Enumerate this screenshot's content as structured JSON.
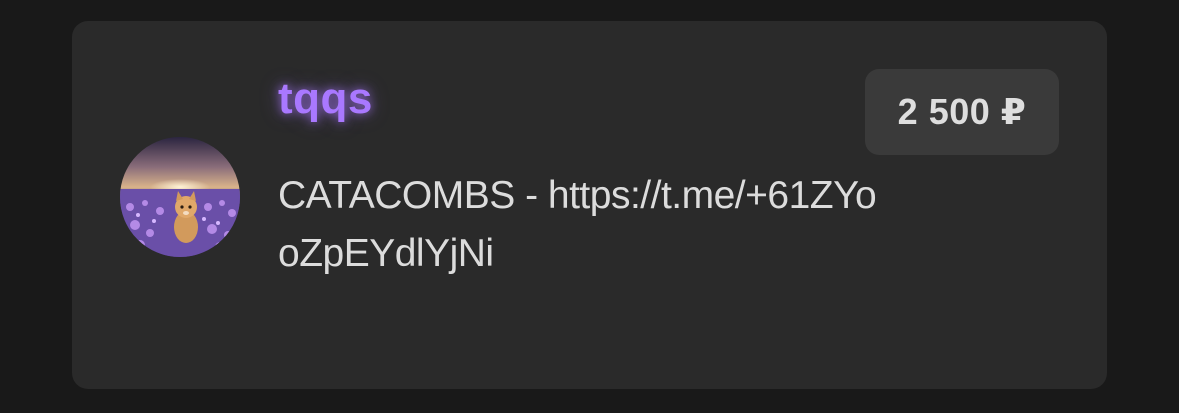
{
  "donation": {
    "username": "tqqs",
    "message": "CATACOMBS - https://t.me/+61ZYooZpEYdlYjNi",
    "amount": "2 500 ₽"
  },
  "colors": {
    "background": "#191919",
    "card": "#2a2a2a",
    "username_accent": "#a978ff",
    "amount_badge": "#3a3a3a",
    "text": "#dcdcdc"
  },
  "avatar": {
    "icon": "cat-in-lavender-field-avatar"
  }
}
